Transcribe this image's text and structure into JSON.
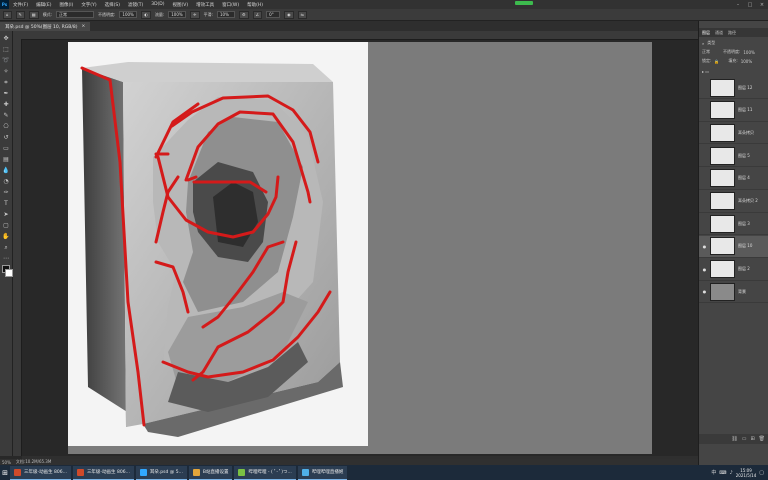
{
  "menu": {
    "items": [
      "文件(F)",
      "编辑(E)",
      "图像(I)",
      "文字(Y)",
      "选择(S)",
      "滤镜(T)",
      "3D(D)",
      "视图(V)",
      "增效工具",
      "窗口(W)",
      "帮助(H)"
    ]
  },
  "options": {
    "style_label": "模式:",
    "style_value": "正常",
    "opacity_label": "不透明度:",
    "opacity_value": "100%",
    "flow_label": "流量:",
    "flow_value": "100%",
    "smooth_label": "平滑:",
    "smooth_value": "10%",
    "angle_value": "0°"
  },
  "document": {
    "tab_title": "耳朵.psd @ 50%(图层 10, RGB/8)",
    "close_glyph": "×"
  },
  "status": {
    "zoom": "50%",
    "info": "文档:10.2M/65.3M"
  },
  "panel": {
    "tabs": [
      "图层",
      "通道",
      "路径"
    ],
    "kind_label": "类型",
    "mode_value": "正常",
    "opacity_label": "不透明度:",
    "opacity_value": "100%",
    "lock_label": "锁定:",
    "fill_label": "填充:",
    "fill_value": "100%",
    "layers": [
      {
        "name": "图层 12",
        "visible": false,
        "selected": false
      },
      {
        "name": "图层 11",
        "visible": false,
        "selected": false
      },
      {
        "name": "耳朵拷贝",
        "visible": false,
        "selected": false
      },
      {
        "name": "图层 5",
        "visible": false,
        "selected": false
      },
      {
        "name": "图层 4",
        "visible": false,
        "selected": false
      },
      {
        "name": "耳朵拷贝 2",
        "visible": false,
        "selected": false
      },
      {
        "name": "图层 3",
        "visible": false,
        "selected": false
      },
      {
        "name": "图层 10",
        "visible": true,
        "selected": true
      },
      {
        "name": "图层 2",
        "visible": true,
        "selected": false
      },
      {
        "name": "背景",
        "visible": true,
        "selected": false
      }
    ],
    "eye_glyph": "●"
  },
  "taskbar": {
    "tasks": [
      {
        "label": "三年级-动画生 806...",
        "color": "#d04a2a"
      },
      {
        "label": "三年级-动画生 806...",
        "color": "#d04a2a"
      },
      {
        "label": "耳朵.psd @ 5...",
        "color": "#31a8ff"
      },
      {
        "label": "B站直播设置",
        "color": "#e2a53a"
      },
      {
        "label": "哔哩哔哩 - ( ﾟ- ﾟ)つ...",
        "color": "#7ac143"
      },
      {
        "label": "哔哩哔哩直播姬",
        "color": "#4fb0e8"
      }
    ],
    "clock_time": "15:09",
    "clock_date": "2021/5/14",
    "lang": "中"
  },
  "colors": {
    "accent_green": "#3dbb4e",
    "sketch_red": "#d41a1a"
  }
}
